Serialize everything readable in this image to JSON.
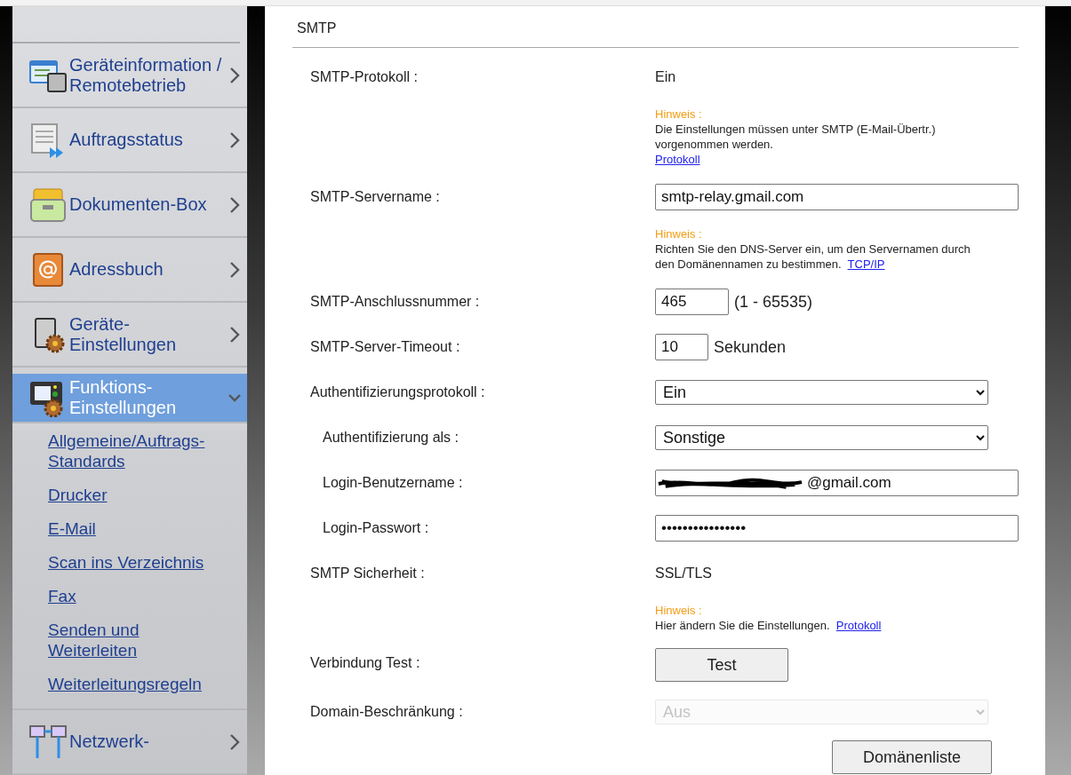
{
  "sidebar": {
    "items": [
      {
        "label": "Geräteinformation / Remotebetrieb",
        "kind": "device-info",
        "selected": false,
        "expanded": false
      },
      {
        "label": "Auftragsstatus",
        "kind": "job-status",
        "selected": false,
        "expanded": false
      },
      {
        "label": "Dokumenten-Box",
        "kind": "document-box",
        "selected": false,
        "expanded": false
      },
      {
        "label": "Adressbuch",
        "kind": "address-book",
        "selected": false,
        "expanded": false
      },
      {
        "label": "Geräte-Einstellungen",
        "kind": "device-settings",
        "selected": false,
        "expanded": false
      },
      {
        "label": "Funktions-Einstellungen",
        "kind": "function-settings",
        "selected": true,
        "expanded": true,
        "children": [
          {
            "label": "Allgemeine/Auftrags-Standards"
          },
          {
            "label": "Drucker"
          },
          {
            "label": "E-Mail"
          },
          {
            "label": "Scan ins Verzeichnis"
          },
          {
            "label": "Fax"
          },
          {
            "label": "Senden und Weiterleiten"
          },
          {
            "label": "Weiterleitungsregeln"
          }
        ]
      },
      {
        "label": "Netzwerk-",
        "kind": "network-settings",
        "selected": false,
        "expanded": false
      }
    ]
  },
  "section": {
    "title": "SMTP",
    "rows": [
      {
        "kind": "text",
        "label": "SMTP-Protokoll :",
        "value": "Ein",
        "note": {
          "heading": "Hinweis :",
          "text": "Die Einstellungen müssen unter SMTP (E-Mail-Übertr.) vorgenommen werden.",
          "link": "Protokoll",
          "link_newline": true
        }
      },
      {
        "kind": "input",
        "label": "SMTP-Servername :",
        "value": "smtp-relay.gmail.com",
        "note": {
          "heading": "Hinweis :",
          "text": "Richten Sie den DNS-Server ein, um den Servernamen durch den Domänennamen zu bestimmen.",
          "link": "TCP/IP",
          "link_newline": false
        }
      },
      {
        "kind": "input",
        "label": "SMTP-Anschlussnummer :",
        "value": "465",
        "suffix": "(1 - 65535)"
      },
      {
        "kind": "input",
        "label": "SMTP-Server-Timeout :",
        "value": "10",
        "suffix": "Sekunden"
      },
      {
        "kind": "select",
        "label": "Authentifizierungsprotokoll :",
        "value": "Ein",
        "disabled": false,
        "children": [
          {
            "kind": "select",
            "label": "Authentifizierung als :",
            "value": "Sonstige",
            "disabled": false
          },
          {
            "kind": "input",
            "label": "Login-Benutzername :",
            "value": "@gmail.com",
            "redacted": true
          },
          {
            "kind": "input",
            "label": "Login-Passwort :",
            "value": "••••••••••••••••"
          }
        ]
      },
      {
        "kind": "text",
        "label": "SMTP Sicherheit :",
        "value": "SSL/TLS",
        "note": {
          "heading": "Hinweis :",
          "text": "Hier ändern Sie die Einstellungen.",
          "link": "Protokoll",
          "link_newline": false
        }
      },
      {
        "kind": "button",
        "label": "Verbindung Test :",
        "value": "Test"
      },
      {
        "kind": "select",
        "label": "Domain-Beschränkung :",
        "value": "Aus",
        "disabled": true
      }
    ],
    "footer_button": "Domänenliste"
  }
}
